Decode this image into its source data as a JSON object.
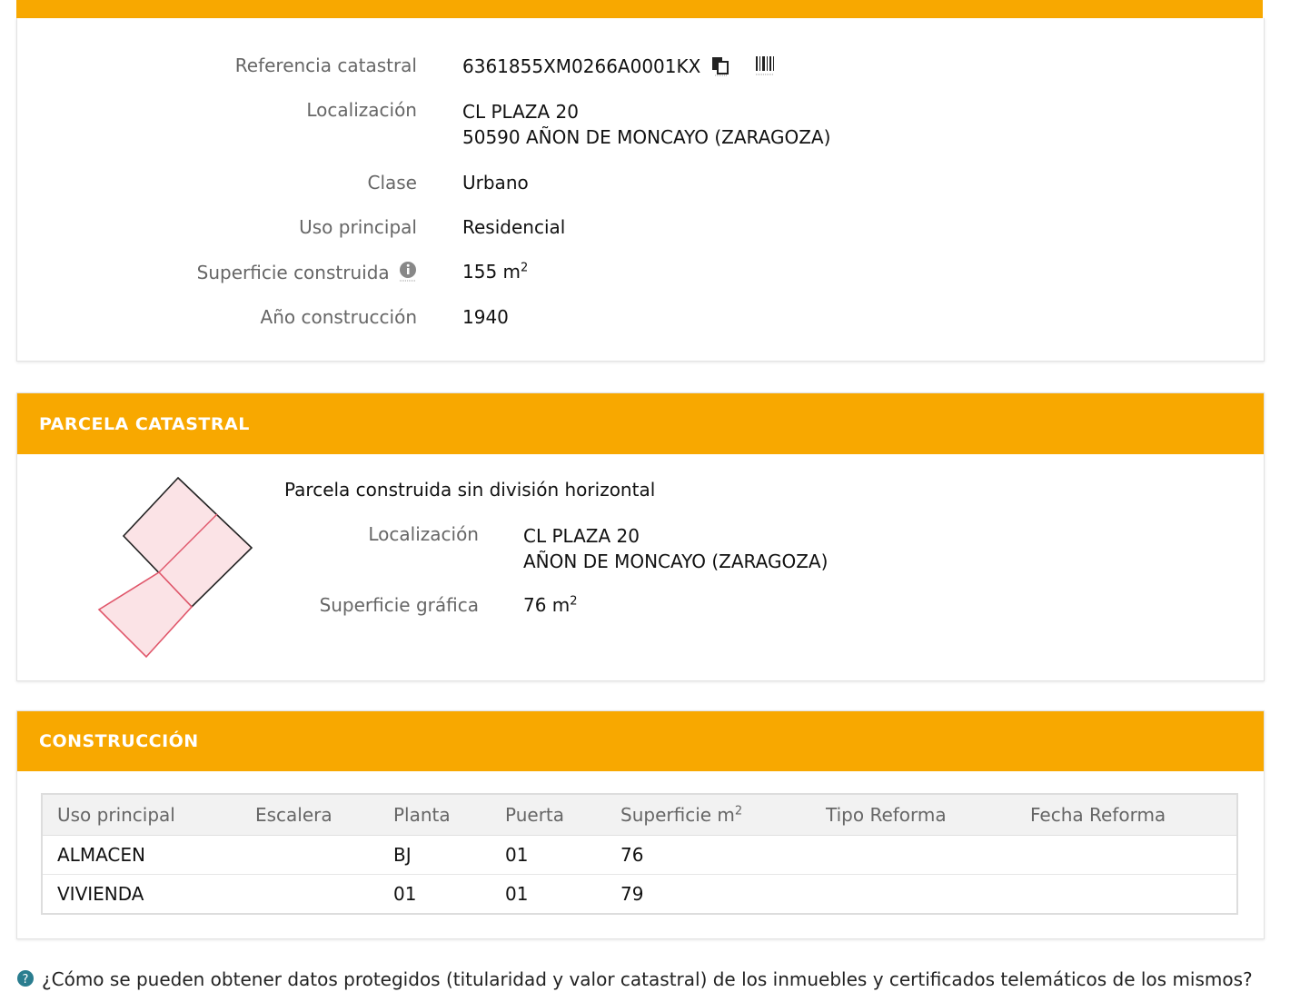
{
  "inmueble": {
    "fields": [
      {
        "label": "Referencia catastral",
        "value": "6361855XM0266A0001KX"
      },
      {
        "label": "Localización",
        "value_line1": "CL PLAZA 20",
        "value_line2": "50590 AÑON DE MONCAYO (ZARAGOZA)"
      },
      {
        "label": "Clase",
        "value": "Urbano"
      },
      {
        "label": "Uso principal",
        "value": "Residencial"
      },
      {
        "label": "Superficie construida",
        "value": "155 m",
        "unit_sup": "2"
      },
      {
        "label": "Año construcción",
        "value": "1940"
      }
    ],
    "icons": [
      "copy-icon",
      "barcode-icon",
      "info-icon"
    ]
  },
  "parcela": {
    "title": "PARCELA CATASTRAL",
    "subtitle": "Parcela construida sin división horizontal",
    "localizacion_label": "Localización",
    "localizacion_line1": "CL PLAZA 20",
    "localizacion_line2": "AÑON DE MONCAYO (ZARAGOZA)",
    "superficie_label": "Superficie gráfica",
    "superficie_value": "76 m",
    "superficie_sup": "2"
  },
  "construccion": {
    "title": "CONSTRUCCIÓN",
    "headers": [
      "Uso principal",
      "Escalera",
      "Planta",
      "Puerta",
      "Superficie m",
      "Tipo Reforma",
      "Fecha Reforma"
    ],
    "header_sup": "2",
    "rows": [
      [
        "ALMACEN",
        "",
        "BJ",
        "01",
        "76",
        "",
        ""
      ],
      [
        "VIVIENDA",
        "",
        "01",
        "01",
        "79",
        "",
        ""
      ]
    ]
  },
  "footer": {
    "question": "¿Cómo se pueden obtener datos protegidos (titularidad y valor catastral) de los inmuebles y certificados telemáticos de los mismos?"
  },
  "colors": {
    "accent": "#f8a800",
    "parcel_fill": "#fbe3e6",
    "parcel_line": "#e0566a"
  }
}
